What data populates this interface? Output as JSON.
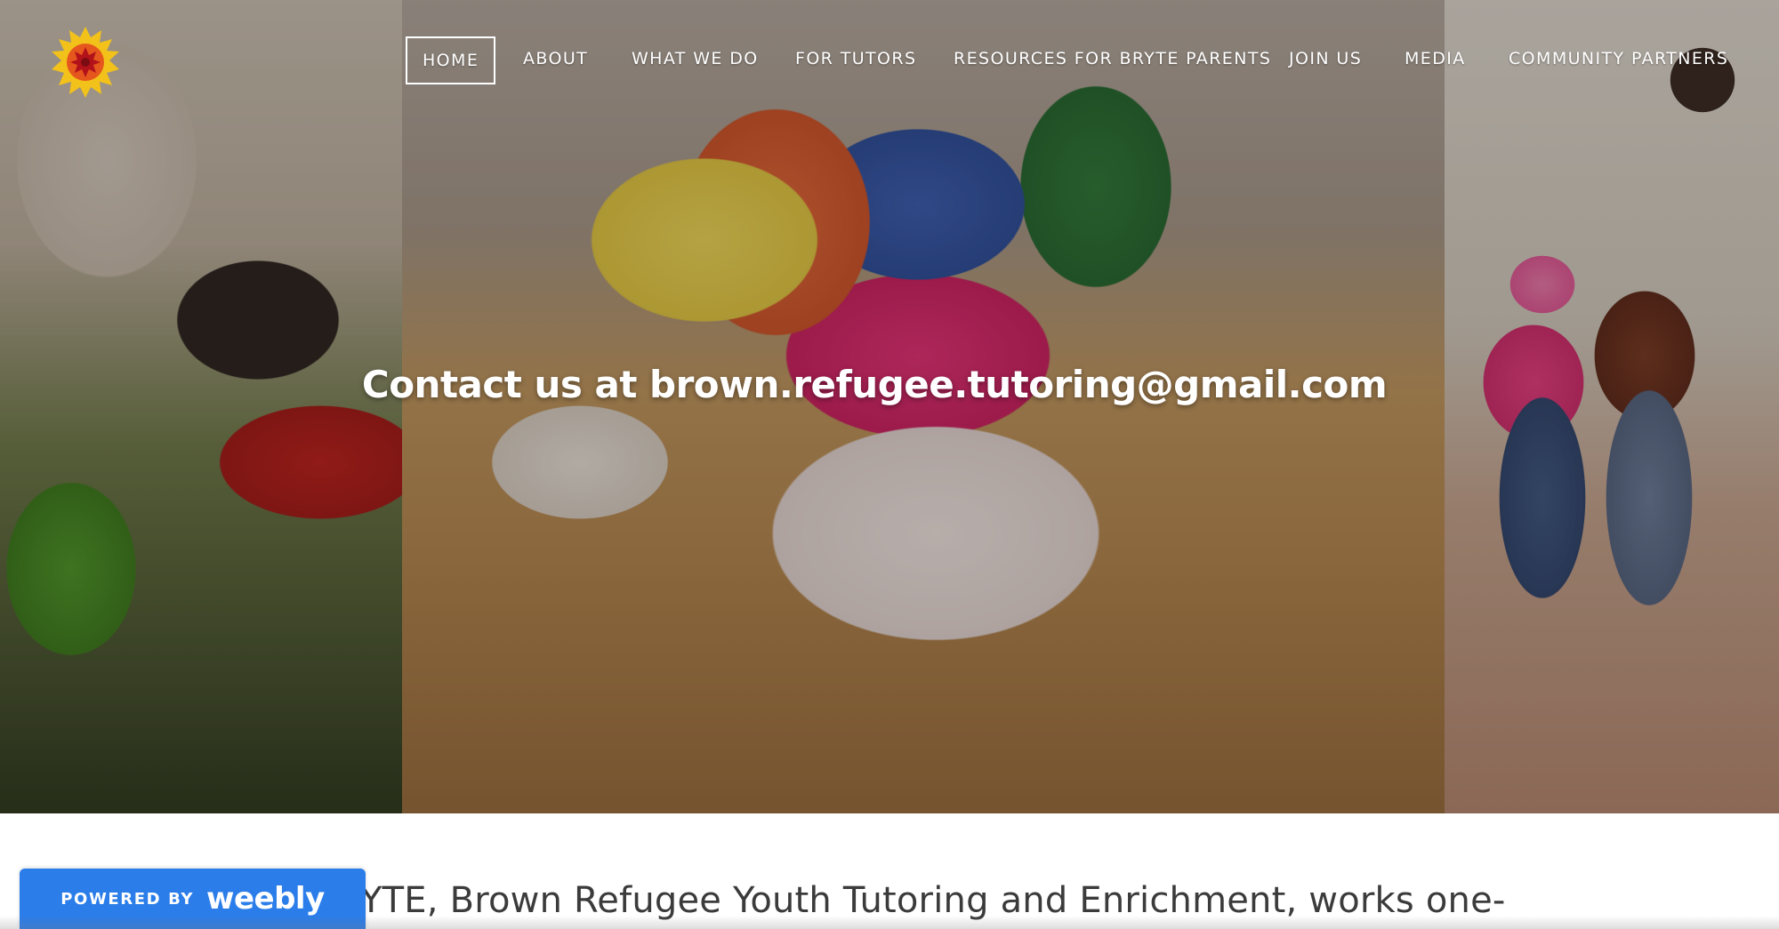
{
  "logo": {
    "icon": "sun-logo-icon",
    "colors": {
      "outer": "#f2c21b",
      "mid": "#e5571c",
      "core": "#b3121b"
    }
  },
  "nav": {
    "items": [
      {
        "label": "HOME",
        "active": true
      },
      {
        "label": "ABOUT",
        "active": false
      },
      {
        "label": "WHAT WE DO",
        "active": false
      },
      {
        "label": "FOR TUTORS",
        "active": false
      },
      {
        "label": "RESOURCES FOR BRYTE PARENTS",
        "active": false
      },
      {
        "label": "JOIN US",
        "active": false
      },
      {
        "label": "MEDIA",
        "active": false
      },
      {
        "label": "COMMUNITY PARTNERS",
        "active": false
      }
    ]
  },
  "hero": {
    "headline": "Contact us at brown.refugee.tutoring@gmail.com"
  },
  "intro": {
    "text": "YTE, Brown Refugee Youth Tutoring and Enrichment, works one-"
  },
  "badge": {
    "small_text": "POWERED BY",
    "brand": "weebly",
    "color": "#2b7de9"
  }
}
